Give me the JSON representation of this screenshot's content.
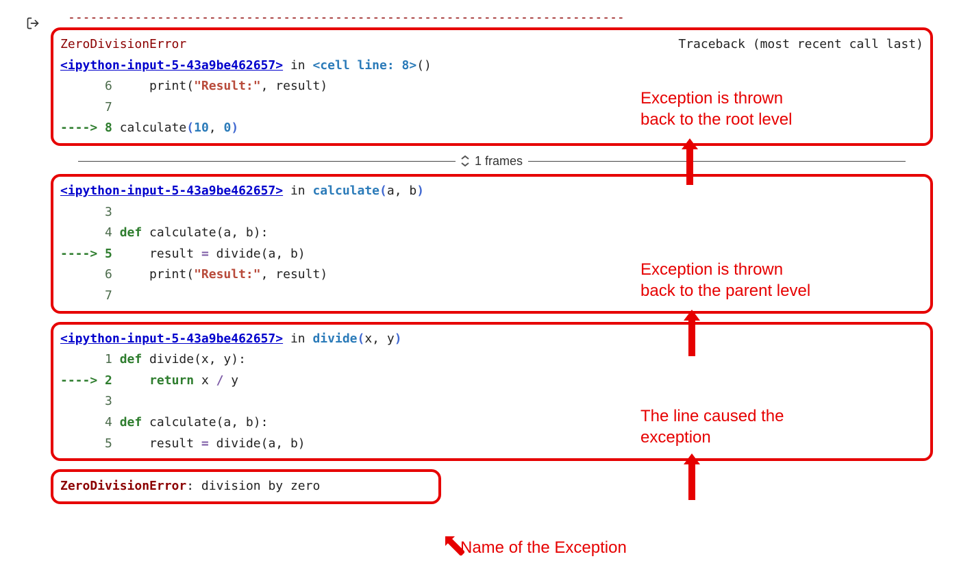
{
  "dashes": "---------------------------------------------------------------------------",
  "exception_name": "ZeroDivisionError",
  "header_traceback": "Traceback",
  "header_recent": " (most recent call last)",
  "frames_label": "1 frames",
  "error_line": {
    "name": "ZeroDivisionError",
    "sep": ": ",
    "msg": "division by zero"
  },
  "frame1": {
    "file_link": "<ipython-input-5-43a9be462657>",
    "in": " in ",
    "cell": "<cell line: 8>",
    "tail": "()",
    "l6_num": "      6 ",
    "l6_code": "    print(",
    "l6_str": "\"Result:\"",
    "l6_rest": ", result)",
    "l7_num": "      7 ",
    "l8_arrow": "----> ",
    "l8_num": "8 ",
    "l8_call": "calculate",
    "l8_p1": "(",
    "l8_a1": "10",
    "l8_sep": ", ",
    "l8_a2": "0",
    "l8_p2": ")"
  },
  "frame2": {
    "file_link": "<ipython-input-5-43a9be462657>",
    "in": " in ",
    "fn": "calculate",
    "sig_open": "(",
    "sig_args": "a, b",
    "sig_close": ")",
    "l3_num": "      3 ",
    "l4_num": "      4 ",
    "l4_def": "def",
    "l4_rest": " calculate(a, b):",
    "l5_arrow": "----> ",
    "l5_num": "5 ",
    "l5_code": "    result ",
    "l5_eq": "=",
    "l5_rest": " divide(a, b)",
    "l6_num": "      6 ",
    "l6_code": "    print(",
    "l6_str": "\"Result:\"",
    "l6_rest": ", result)",
    "l7_num": "      7 "
  },
  "frame3": {
    "file_link": "<ipython-input-5-43a9be462657>",
    "in": " in ",
    "fn": "divide",
    "sig_open": "(",
    "sig_args": "x, y",
    "sig_close": ")",
    "l1_num": "      1 ",
    "l1_def": "def",
    "l1_rest": " divide(x, y):",
    "l2_arrow": "----> ",
    "l2_num": "2 ",
    "l2_code": "    ",
    "l2_ret": "return",
    "l2_expr_a": " x ",
    "l2_op": "/",
    "l2_expr_b": " y",
    "l3_num": "      3 ",
    "l4_num": "      4 ",
    "l4_def": "def",
    "l4_rest": " calculate(a, b):",
    "l5_num": "      5 ",
    "l5_code": "    result ",
    "l5_eq": "=",
    "l5_rest": " divide(a, b)"
  },
  "annotations": {
    "root": "Exception is thrown\nback to the root level",
    "parent": "Exception is thrown\nback to the parent level",
    "line": "The line caused the\nexception",
    "name": "Name of the Exception"
  }
}
